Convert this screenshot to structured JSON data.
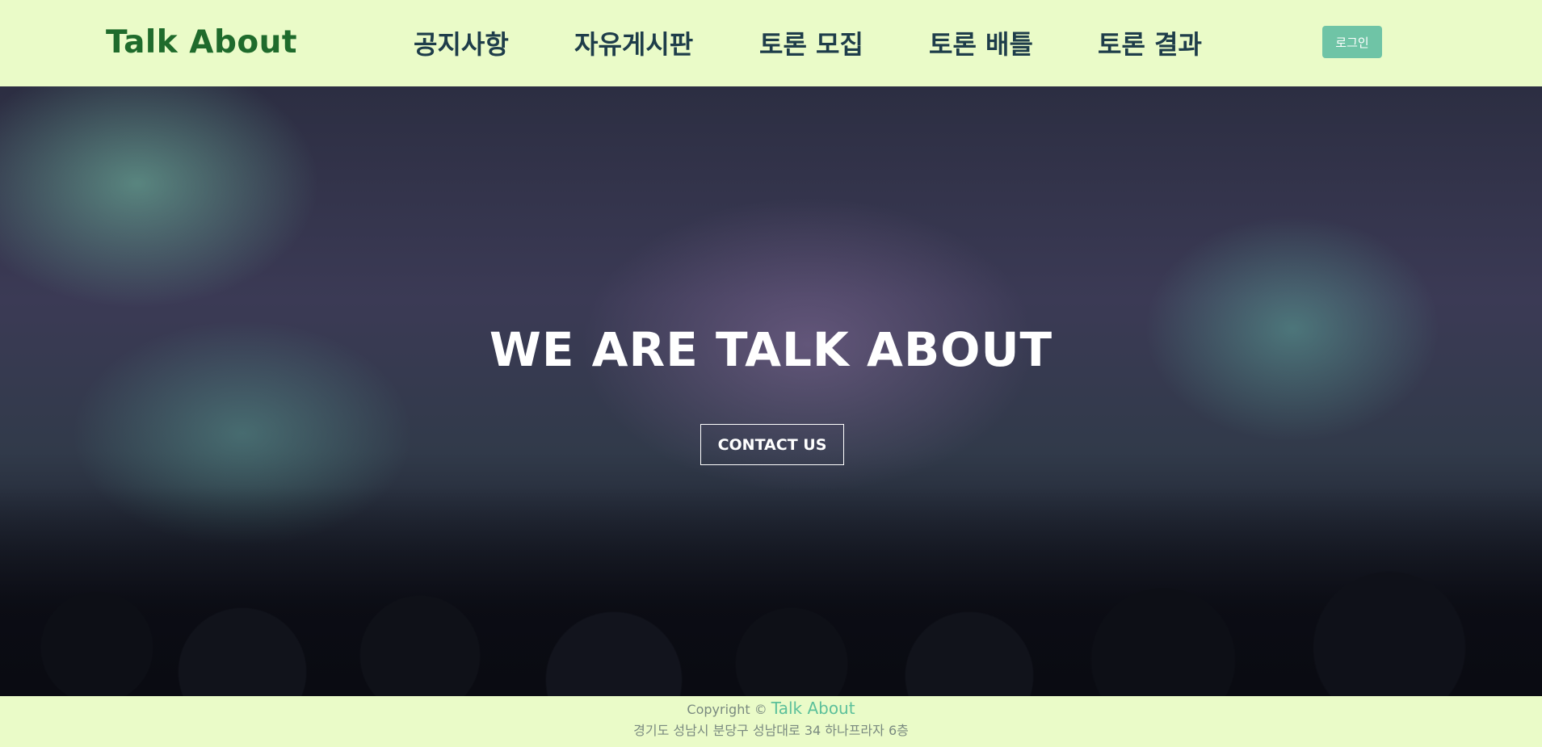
{
  "header": {
    "logo": "Talk About",
    "nav": [
      "공지사항",
      "자유게시판",
      "토론 모집",
      "토론 배틀",
      "토론 결과"
    ],
    "login_label": "로그인"
  },
  "hero": {
    "title": "WE ARE TALK ABOUT",
    "contact_label": "CONTACT US"
  },
  "footer": {
    "copyright_prefix": "Copyright ©",
    "brand": "Talk About",
    "address": "경기도 성남시 분당구 성남대로 34 하나프라자 6층"
  },
  "colors": {
    "header_bg": "#eafbc8",
    "logo": "#1f6b2c",
    "nav_text": "#1e3d4a",
    "login_button": "#6fc4a6",
    "footer_brand": "#5cc09a"
  }
}
